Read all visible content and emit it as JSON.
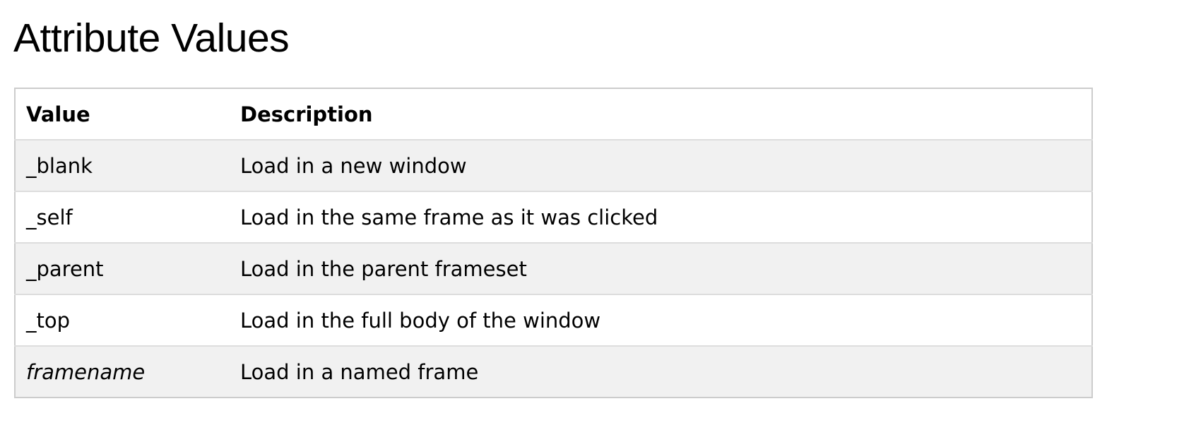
{
  "title": "Attribute Values",
  "table": {
    "headers": {
      "value": "Value",
      "description": "Description"
    },
    "rows": [
      {
        "value": "_blank",
        "description": "Load in a new window"
      },
      {
        "value": "_self",
        "description": "Load in the same frame as it was clicked"
      },
      {
        "value": "_parent",
        "description": "Load in the parent frameset"
      },
      {
        "value": "_top",
        "description": "Load in the full body of the window"
      },
      {
        "value": "framename",
        "description": "Load in a named frame"
      }
    ]
  }
}
